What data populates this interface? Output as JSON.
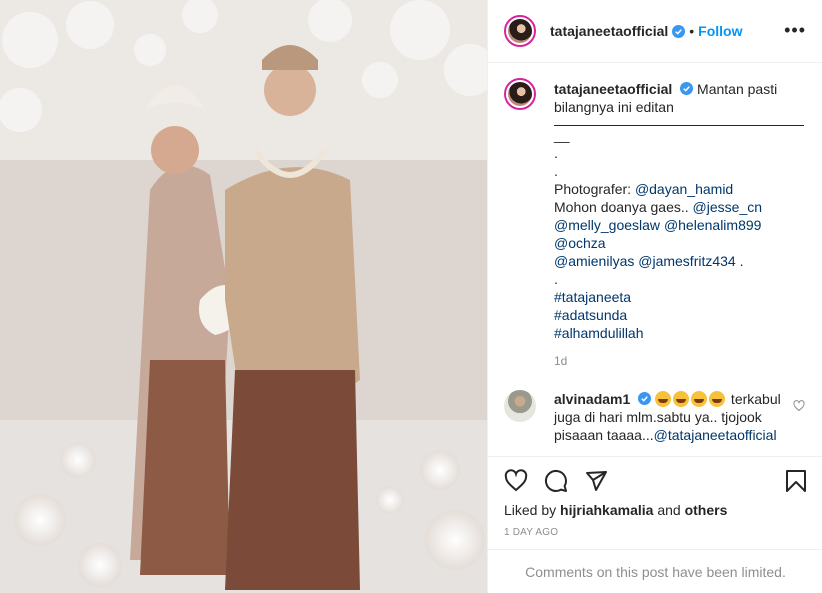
{
  "post": {
    "author": "tatajaneeta​official",
    "follow_label": "Follow",
    "separator": "•",
    "more_label": "•••",
    "caption_lines": [
      "Mantan pasti",
      "bilangnya ini editan"
    ],
    "dash_tail": "__",
    "dot1": ".",
    "dot2": ".",
    "photographer_label": "Photografer: ",
    "photographer_link": "@dayan_hamid",
    "prayer_text": "Mohon doanya gaes.. ",
    "mention_1": "@jesse_cn",
    "mention_2": "@melly_goeslaw",
    "mention_3": "@helenalim899",
    "mention_4": "@ochza",
    "mention_5": "@amienilyas",
    "mention_6": "@jamesfritz434",
    "mention_end": " .",
    "dot3": ".",
    "hashtag_1": "#tatajaneeta",
    "hashtag_2": "#adatsunda",
    "hashtag_3": "#alhamdulillah",
    "caption_age": "1d"
  },
  "comment": {
    "author": "alvinadam1",
    "text_after_emoji": " terkabul",
    "line2": "juga di hari mlm.sabtu ya.. tjojook",
    "line3": "pisaaan taaaa...",
    "mention": "@tatajaneetaofficial"
  },
  "likes": {
    "prefix": "Liked by ",
    "user": "hijriahkamalia",
    "middle": " and ",
    "others": "others"
  },
  "post_age": "1 DAY AGO",
  "limited_notice": "Comments on this post have been limited.",
  "colors": {
    "accent": "#0095f6",
    "link": "#00376b",
    "muted": "#8e8e8e",
    "verified": "#3897f0"
  },
  "icons": [
    "verified-badge-icon",
    "heart-icon",
    "comment-icon",
    "share-icon",
    "bookmark-icon",
    "more-icon"
  ]
}
